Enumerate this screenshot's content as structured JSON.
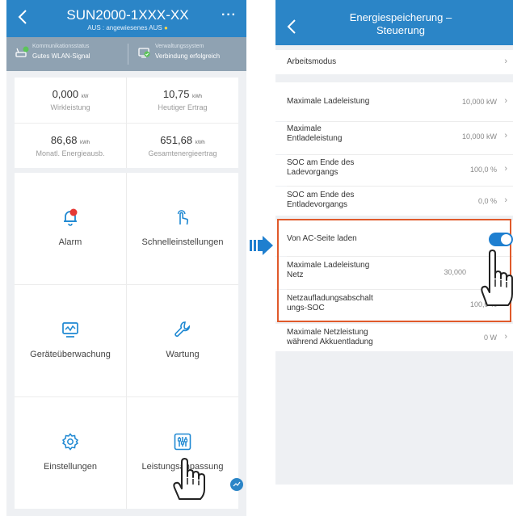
{
  "left": {
    "header": {
      "title": "SUN2000-1XXX-XX",
      "subtitle": "AUS : angewiesenes AUS",
      "more": "···"
    },
    "status": {
      "comm_label": "Kommunikationsstatus",
      "comm_value": "Gutes WLAN-Signal",
      "mgmt_label": "Verwaltungssystem",
      "mgmt_value": "Verbindung erfolgreich"
    },
    "stats": [
      {
        "value": "0,000",
        "unit": "kW",
        "caption": "Wirkleistung"
      },
      {
        "value": "10,75",
        "unit": "kWh",
        "caption": "Heutiger Ertrag"
      },
      {
        "value": "86,68",
        "unit": "kWh",
        "caption": "Monatl. Energieausb."
      },
      {
        "value": "651,68",
        "unit": "kWh",
        "caption": "Gesamtenergieertrag"
      }
    ],
    "tiles": [
      {
        "label": "Alarm",
        "icon": "alarm-bell-icon"
      },
      {
        "label": "Schnelleinstellungen",
        "icon": "quick-settings-hand-icon"
      },
      {
        "label": "Geräteüberwachung",
        "icon": "device-monitor-icon"
      },
      {
        "label": "Wartung",
        "icon": "maintenance-wrench-icon"
      },
      {
        "label": "Einstellungen",
        "icon": "settings-gear-icon"
      },
      {
        "label": "Leistungsanpassung",
        "icon": "power-adjust-sliders-icon"
      }
    ]
  },
  "right": {
    "header": {
      "title_line1": "Energiespeicherung –",
      "title_line2": "Steuerung"
    },
    "mode": {
      "label": "Arbeitsmodus"
    },
    "rows": [
      {
        "label_line1": "Maximale Ladeleistung",
        "label_line2": "",
        "value": "10,000 kW"
      },
      {
        "label_line1": "Maximale",
        "label_line2": "Entladeleistung",
        "value": "10,000 kW"
      },
      {
        "label_line1": "SOC am Ende des",
        "label_line2": "Ladevorgangs",
        "value": "100,0 %"
      },
      {
        "label_line1": "SOC am Ende des",
        "label_line2": "Entladevorgangs",
        "value": "0,0 %"
      }
    ],
    "ac": {
      "toggle_label": "Von AC-Seite laden",
      "toggle_on": true,
      "grid_power_line1": "Maximale Ladeleistung",
      "grid_power_line2": "Netz",
      "grid_power_value": "30,000",
      "cutoff_line1": "Netzaufladungsabschalt",
      "cutoff_line2": "ungs-SOC",
      "cutoff_value": "100,0 %"
    },
    "last": {
      "label_line1": "Maximale Netzleistung",
      "label_line2": "während Akkuentladung",
      "value": "0 W"
    }
  },
  "colors": {
    "header_blue": "#2b85c7",
    "status_gray": "#8fa2b2",
    "highlight_orange": "#e05a2b",
    "toggle_blue": "#1e7fd0",
    "alarm_red": "#e53935",
    "online_green": "#5cc45a"
  }
}
